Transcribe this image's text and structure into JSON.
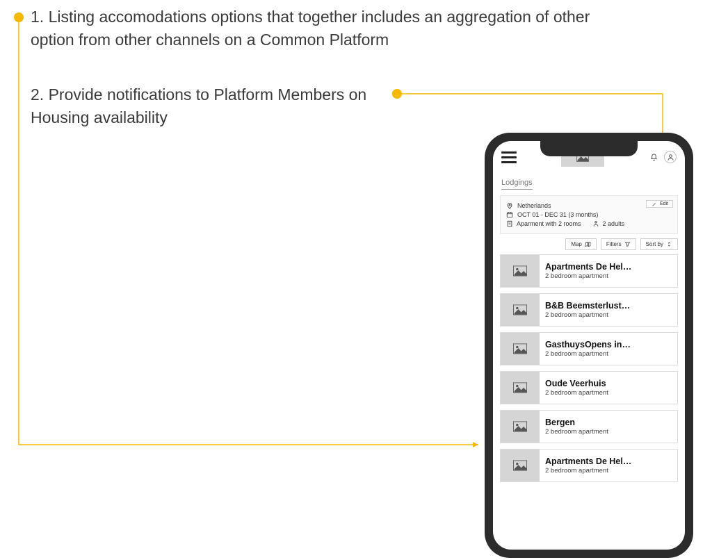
{
  "annotations": {
    "a1": "1. Listing accomodations options that together includes an aggregation of other option from other channels on a Common Platform",
    "a2": "2. Provide notifications to Platform Members on Housing availability"
  },
  "colors": {
    "accent": "#f6b800"
  },
  "topbar": {
    "menu_name": "menu",
    "bell_name": "notifications",
    "user_name": "account"
  },
  "tabs": {
    "active": "Lodgings"
  },
  "summary": {
    "location": "Netherlands",
    "dates": "OCT 01 - DEC 31 (3 months)",
    "type": "Aparment with 2 rooms",
    "guests": "2 adults",
    "edit_label": "Edit"
  },
  "controls": {
    "map": "Map",
    "filters": "Filters",
    "sort": "Sort by"
  },
  "listings": [
    {
      "title": "Apartments De Hel…",
      "sub": "2 bedroom apartment"
    },
    {
      "title": "B&B Beemsterlust…",
      "sub": "2 bedroom apartment"
    },
    {
      "title": "GasthuysOpens in…",
      "sub": "2 bedroom apartment"
    },
    {
      "title": "Oude Veerhuis",
      "sub": "2 bedroom apartment"
    },
    {
      "title": "Bergen",
      "sub": "2 bedroom apartment"
    },
    {
      "title": "Apartments De Hel…",
      "sub": "2 bedroom apartment"
    }
  ]
}
